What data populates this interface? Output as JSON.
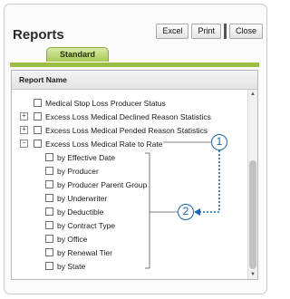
{
  "page_title": "Reports",
  "toolbar": {
    "excel": "Excel",
    "print": "Print",
    "close": "Close"
  },
  "tabs": [
    {
      "label": "Standard",
      "active": true
    }
  ],
  "panel": {
    "header": "Report Name",
    "items": [
      {
        "label": "Medical Stop Loss Producer Status",
        "expander": ""
      },
      {
        "label": "Excess Loss Medical Declined Reason Statistics",
        "expander": "+"
      },
      {
        "label": "Excess Loss Medical Pended Reason Statistics",
        "expander": "+"
      },
      {
        "label": "Excess Loss Medical Rate to Rate",
        "expander": "−"
      }
    ],
    "sub_items": [
      "by Effective Date",
      "by Producer",
      "by Producer Parent Group",
      "by Underwriter",
      "by Deductible",
      "by Contract Type",
      "by Office",
      "by Renewal Tier",
      "by State"
    ]
  },
  "callouts": [
    "1",
    "2"
  ],
  "colors": {
    "accent_green": "#9ebd45",
    "callout_blue": "#1768b0"
  }
}
